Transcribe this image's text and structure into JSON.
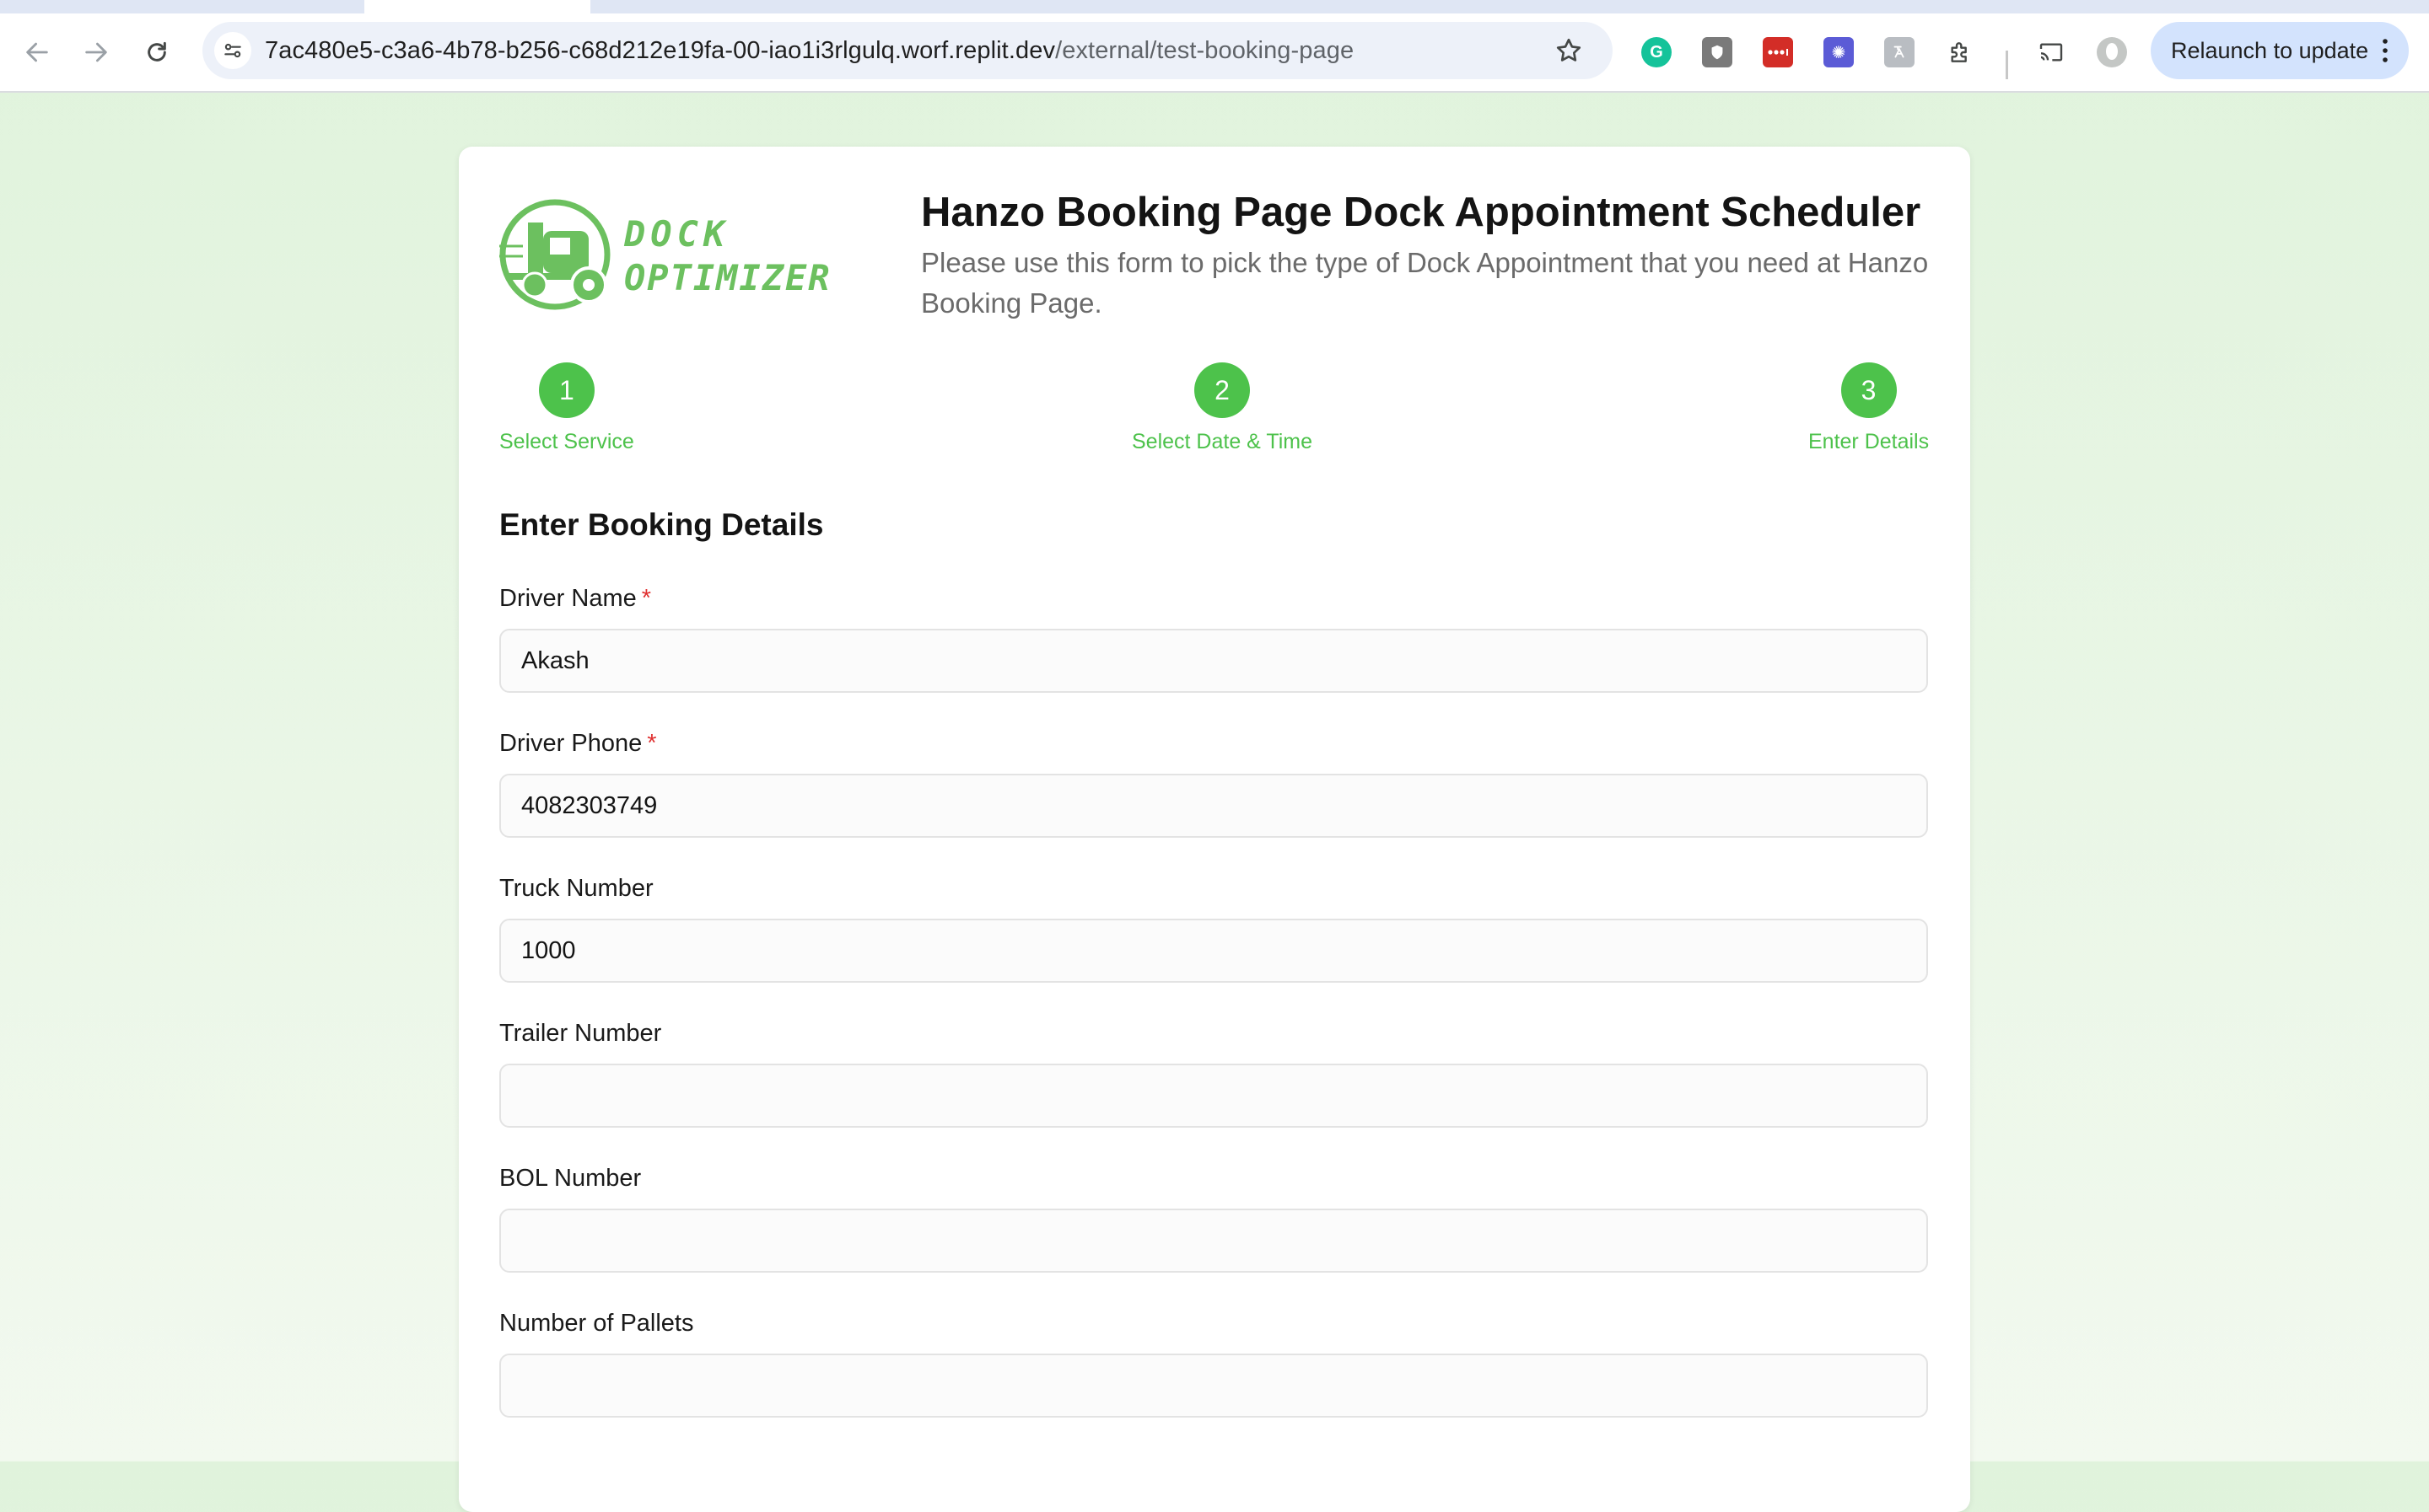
{
  "browser": {
    "url_host": "7ac480e5-c3a6-4b78-b256-c68d212e19fa-00-iao1i3rlgulq.worf.replit.dev",
    "url_path": "/external/test-booking-page",
    "relaunch_label": "Relaunch to update",
    "extensions": [
      {
        "icon": "grammarly-icon",
        "color": "#15c39a"
      },
      {
        "icon": "shield-icon",
        "color": "#7a7a7a"
      },
      {
        "icon": "lastpass-icon",
        "color": "#d32d27"
      },
      {
        "icon": "sparkle-icon",
        "color": "#5b5bd6"
      },
      {
        "icon": "translate-icon",
        "color": "#9aa0a6"
      },
      {
        "icon": "puzzle-icon",
        "color": "#444746"
      }
    ]
  },
  "header": {
    "logo_line1": "DOCK",
    "logo_line2": "OPTIMIZER",
    "title": "Hanzo Booking Page Dock Appointment Scheduler",
    "subtitle": "Please use this form to pick the type of Dock Appointment that you need at Hanzo Booking Page."
  },
  "steps": [
    {
      "number": "1",
      "label": "Select Service"
    },
    {
      "number": "2",
      "label": "Select Date & Time"
    },
    {
      "number": "3",
      "label": "Enter Details"
    }
  ],
  "form": {
    "section_title": "Enter Booking Details",
    "fields": [
      {
        "label": "Driver Name",
        "required": true,
        "value": "Akash"
      },
      {
        "label": "Driver Phone",
        "required": true,
        "value": "4082303749"
      },
      {
        "label": "Truck Number",
        "required": false,
        "value": "1000"
      },
      {
        "label": "Trailer Number",
        "required": false,
        "value": ""
      },
      {
        "label": "BOL Number",
        "required": false,
        "value": ""
      },
      {
        "label": "Number of Pallets",
        "required": false,
        "value": ""
      }
    ],
    "required_marker": "*"
  },
  "colors": {
    "accent": "#4dc24b",
    "logo_green": "#6cc05f",
    "required": "#e03131"
  }
}
